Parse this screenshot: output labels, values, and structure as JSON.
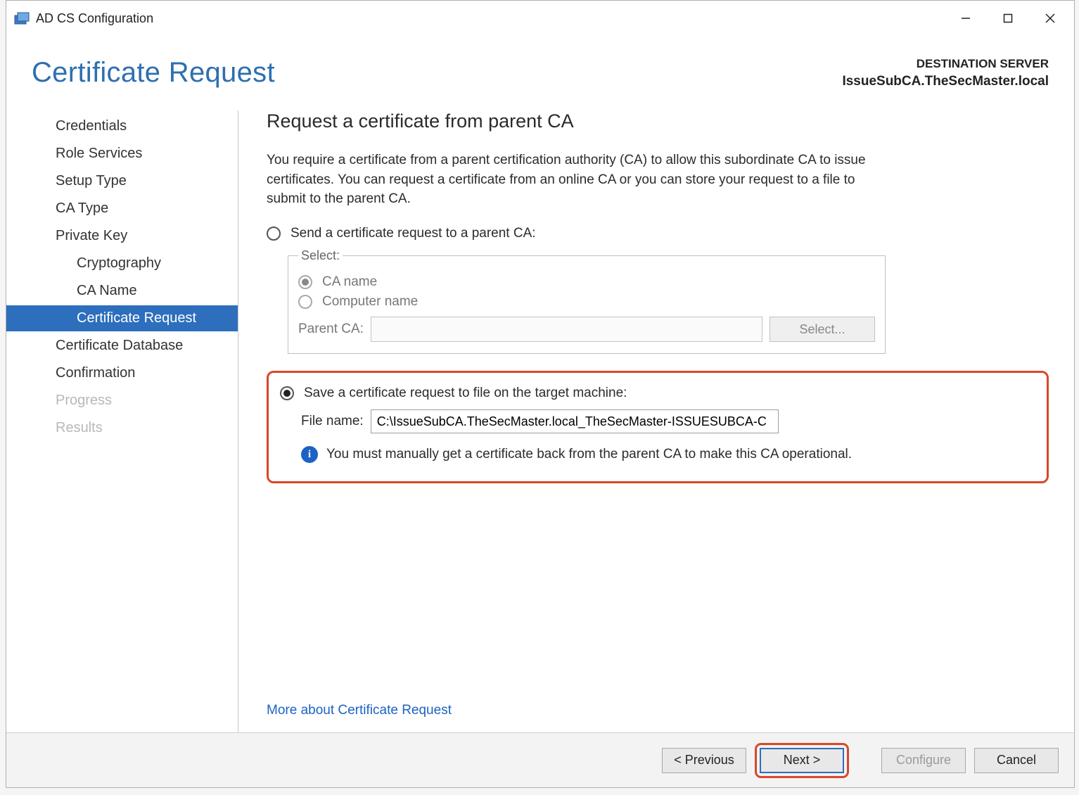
{
  "titlebar": {
    "app_title": "AD CS Configuration"
  },
  "header": {
    "page_title": "Certificate Request",
    "destination_label": "DESTINATION SERVER",
    "destination_server": "IssueSubCA.TheSecMaster.local"
  },
  "sidebar": {
    "items": [
      {
        "label": "Credentials",
        "indent": 0
      },
      {
        "label": "Role Services",
        "indent": 0
      },
      {
        "label": "Setup Type",
        "indent": 0
      },
      {
        "label": "CA Type",
        "indent": 0
      },
      {
        "label": "Private Key",
        "indent": 0
      },
      {
        "label": "Cryptography",
        "indent": 1
      },
      {
        "label": "CA Name",
        "indent": 1
      },
      {
        "label": "Certificate Request",
        "indent": 1,
        "active": true
      },
      {
        "label": "Certificate Database",
        "indent": 0
      },
      {
        "label": "Confirmation",
        "indent": 0
      },
      {
        "label": "Progress",
        "indent": 0,
        "disabled": true
      },
      {
        "label": "Results",
        "indent": 0,
        "disabled": true
      }
    ]
  },
  "main": {
    "heading": "Request a certificate from parent CA",
    "intro": "You require a certificate from a parent certification authority (CA) to allow this subordinate CA to issue certificates. You can request a certificate from an online CA or you can store your request to a file to submit to the parent CA.",
    "option_send": "Send a certificate request to a parent CA:",
    "select_legend": "Select:",
    "sub_ca_name": "CA name",
    "sub_computer_name": "Computer name",
    "parent_ca_label": "Parent CA:",
    "select_button": "Select...",
    "option_save": "Save a certificate request to file on the target machine:",
    "file_name_label": "File name:",
    "file_name_value": "C:\\IssueSubCA.TheSecMaster.local_TheSecMaster-ISSUESUBCA-C",
    "info_text": "You must manually get a certificate back from the parent CA to make this CA operational.",
    "more_link": "More about Certificate Request"
  },
  "footer": {
    "previous": "< Previous",
    "next": "Next >",
    "configure": "Configure",
    "cancel": "Cancel"
  }
}
